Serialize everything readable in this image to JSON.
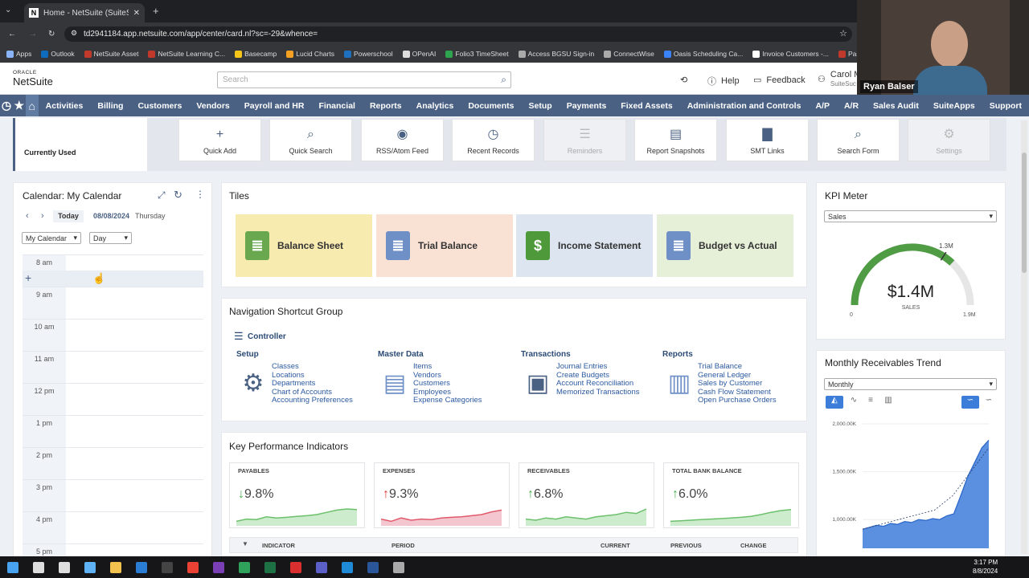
{
  "browser": {
    "tab_title": "Home - NetSuite (SuiteSuccess",
    "tab_favicon": "N",
    "url": "td2941184.app.netsuite.com/app/center/card.nl?sc=-29&whence=",
    "bookmarks": [
      {
        "label": "Apps",
        "color": "#8ab4f8"
      },
      {
        "label": "Outlook",
        "color": "#0f6cbd"
      },
      {
        "label": "NetSuite Asset",
        "color": "#c0392b"
      },
      {
        "label": "NetSuite Learning C...",
        "color": "#c0392b"
      },
      {
        "label": "Basecamp",
        "color": "#f5c518"
      },
      {
        "label": "Lucid Charts",
        "color": "#f4a023"
      },
      {
        "label": "Powerschool",
        "color": "#1f6fbf"
      },
      {
        "label": "OPenAI",
        "color": "#dddddd"
      },
      {
        "label": "Folio3 TimeSheet",
        "color": "#2ea44f"
      },
      {
        "label": "Access BGSU Sign-in",
        "color": "#aaaaaa"
      },
      {
        "label": "ConnectWise",
        "color": "#aaaaaa"
      },
      {
        "label": "Oasis Scheduling Ca...",
        "color": "#3b82f6"
      },
      {
        "label": "Invoice Customers -...",
        "color": "#ffffff"
      },
      {
        "label": "Password Check",
        "color": "#c0392b"
      }
    ]
  },
  "header": {
    "logo_oracle": "ORACLE",
    "logo_netsuite": "NetSuite",
    "search_placeholder": "Search",
    "help": "Help",
    "feedback": "Feedback",
    "user_name": "Carol M",
    "user_sub": "SuiteSuc"
  },
  "webcam": {
    "name": "Ryan Balser"
  },
  "nav": {
    "items": [
      "Activities",
      "Billing",
      "Customers",
      "Vendors",
      "Payroll and HR",
      "Financial",
      "Reports",
      "Analytics",
      "Documents",
      "Setup",
      "Payments",
      "Fixed Assets",
      "Administration and Controls",
      "A/P",
      "A/R",
      "Sales Audit",
      "SuiteApps",
      "Support"
    ]
  },
  "shortcuts": {
    "group_label": "Currently Used",
    "items": [
      {
        "label": "Quick Add",
        "icon": "+",
        "icon_name": "plus-icon",
        "disabled": false
      },
      {
        "label": "Quick Search",
        "icon": "⌕",
        "icon_name": "search-icon",
        "disabled": false
      },
      {
        "label": "RSS/Atom Feed",
        "icon": "◉",
        "icon_name": "rss-icon",
        "disabled": false
      },
      {
        "label": "Recent Records",
        "icon": "◷",
        "icon_name": "clock-icon",
        "disabled": false
      },
      {
        "label": "Reminders",
        "icon": "☰",
        "icon_name": "checklist-icon",
        "disabled": true
      },
      {
        "label": "Report Snapshots",
        "icon": "▤",
        "icon_name": "report-icon",
        "disabled": false
      },
      {
        "label": "SMT Links",
        "icon": "▇",
        "icon_name": "document-icon",
        "disabled": false
      },
      {
        "label": "Search Form",
        "icon": "⌕",
        "icon_name": "search-form-icon",
        "disabled": false
      },
      {
        "label": "Settings",
        "icon": "⚙",
        "icon_name": "gear-icon",
        "disabled": true
      }
    ]
  },
  "calendar": {
    "title": "Calendar: My Calendar",
    "today_btn": "Today",
    "date": "08/08/2024",
    "weekday": "Thursday",
    "calendar_select": "My Calendar",
    "view_select": "Day",
    "hours": [
      "8 am",
      "9 am",
      "10 am",
      "11 am",
      "12 pm",
      "1 pm",
      "2 pm",
      "3 pm",
      "4 pm",
      "5 pm"
    ]
  },
  "tiles": {
    "title": "Tiles",
    "items": [
      {
        "label": "Balance Sheet",
        "bg": "#f8ebb0",
        "icon_color": "#6aa84f"
      },
      {
        "label": "Trial Balance",
        "bg": "#f9e1d4",
        "icon_color": "#6f8fc7"
      },
      {
        "label": "Income Statement",
        "bg": "#dde5f0",
        "icon_color": "#4e9a3a"
      },
      {
        "label": "Budget vs Actual",
        "bg": "#e6efd8",
        "icon_color": "#6f8fc7"
      }
    ]
  },
  "nav_shortcuts": {
    "title": "Navigation Shortcut Group",
    "group": "Controller",
    "columns": [
      {
        "heading": "Setup",
        "links": [
          "Classes",
          "Locations",
          "Departments",
          "Chart of Accounts",
          "Accounting Preferences"
        ]
      },
      {
        "heading": "Master Data",
        "links": [
          "Items",
          "Vendors",
          "Customers",
          "Employees",
          "Expense Categories"
        ]
      },
      {
        "heading": "Transactions",
        "links": [
          "Journal Entries",
          "Create Budgets",
          "Account Reconciliation",
          "Memorized Transactions"
        ]
      },
      {
        "heading": "Reports",
        "links": [
          "Trial Balance",
          "General Ledger",
          "Sales by Customer",
          "Cash Flow Statement",
          "Open Purchase Orders"
        ]
      }
    ]
  },
  "kpis": {
    "title": "Key Performance Indicators",
    "cards": [
      {
        "label": "PAYABLES",
        "value": "9.8%",
        "arrow": "↓",
        "arrow_color": "#4caf50",
        "line_color": "#6cc06c",
        "fill": "#cdebcd",
        "points": [
          0.2,
          0.3,
          0.28,
          0.4,
          0.35,
          0.38,
          0.42,
          0.45,
          0.5,
          0.6,
          0.7,
          0.75,
          0.72
        ]
      },
      {
        "label": "EXPENSES",
        "value": "9.3%",
        "arrow": "↑",
        "arrow_color": "#e53935",
        "line_color": "#e05a6c",
        "fill": "#f4c6cf",
        "points": [
          0.3,
          0.2,
          0.35,
          0.25,
          0.3,
          0.28,
          0.35,
          0.38,
          0.4,
          0.45,
          0.5,
          0.62,
          0.7
        ]
      },
      {
        "label": "RECEIVABLES",
        "value": "6.8%",
        "arrow": "↑",
        "arrow_color": "#4caf50",
        "line_color": "#6cc06c",
        "fill": "#cdebcd",
        "points": [
          0.3,
          0.25,
          0.35,
          0.3,
          0.4,
          0.35,
          0.3,
          0.4,
          0.45,
          0.5,
          0.6,
          0.55,
          0.75
        ]
      },
      {
        "label": "TOTAL BANK BALANCE",
        "value": "6.0%",
        "arrow": "↑",
        "arrow_color": "#4caf50",
        "line_color": "#6cc06c",
        "fill": "#cdebcd",
        "points": [
          0.2,
          0.22,
          0.25,
          0.28,
          0.3,
          0.32,
          0.35,
          0.38,
          0.42,
          0.5,
          0.6,
          0.68,
          0.72
        ]
      }
    ],
    "table_headers": [
      "INDICATOR",
      "PERIOD",
      "CURRENT",
      "PREVIOUS",
      "CHANGE"
    ]
  },
  "kpi_meter": {
    "title": "KPI Meter",
    "select": "Sales",
    "value_label": "$1.4M",
    "sub_label": "SALES",
    "min": "0",
    "max": "1.9M",
    "target": "1.3M",
    "fraction": 0.74,
    "target_fraction": 0.68
  },
  "receivables": {
    "title": "Monthly Receivables Trend",
    "select": "Monthly"
  },
  "chart_data": {
    "type": "area",
    "title": "Monthly Receivables Trend",
    "yticks": [
      "2,000.00K",
      "1,500.00K",
      "1,000.00K"
    ],
    "ylim": [
      700000,
      2000000
    ],
    "values": [
      900000,
      920000,
      940000,
      930000,
      960000,
      950000,
      980000,
      970000,
      1000000,
      990000,
      1010000,
      1000000,
      1040000,
      1060000,
      1250000,
      1450000,
      1600000,
      1750000,
      1830000
    ],
    "trend": [
      900000,
      950000,
      1000000,
      1050000,
      1100000,
      1250000,
      1500000,
      1750000
    ]
  },
  "taskbar": {
    "time": "3:17 PM",
    "date": "8/8/2024",
    "apps": [
      {
        "name": "windows-icon",
        "color": "#4aa3f0"
      },
      {
        "name": "search-icon",
        "color": "#dddddd"
      },
      {
        "name": "task-view-icon",
        "color": "#dddddd"
      },
      {
        "name": "settings-app-icon",
        "color": "#5fb3f5"
      },
      {
        "name": "file-explorer-icon",
        "color": "#f2c24f"
      },
      {
        "name": "outlook-icon",
        "color": "#2b7cd3"
      },
      {
        "name": "dell-icon",
        "color": "#444"
      },
      {
        "name": "chrome-icon",
        "color": "#e94235"
      },
      {
        "name": "onenote-icon",
        "color": "#7b3fb5"
      },
      {
        "name": "vpn-icon",
        "color": "#2fa15b"
      },
      {
        "name": "excel-icon",
        "color": "#1e7145"
      },
      {
        "name": "acrobat-icon",
        "color": "#d9302f"
      },
      {
        "name": "teams-icon",
        "color": "#5b5fc7"
      },
      {
        "name": "edge-icon",
        "color": "#1f8ad6"
      },
      {
        "name": "word-icon",
        "color": "#2b579a"
      },
      {
        "name": "snip-icon",
        "color": "#aaa"
      }
    ]
  }
}
